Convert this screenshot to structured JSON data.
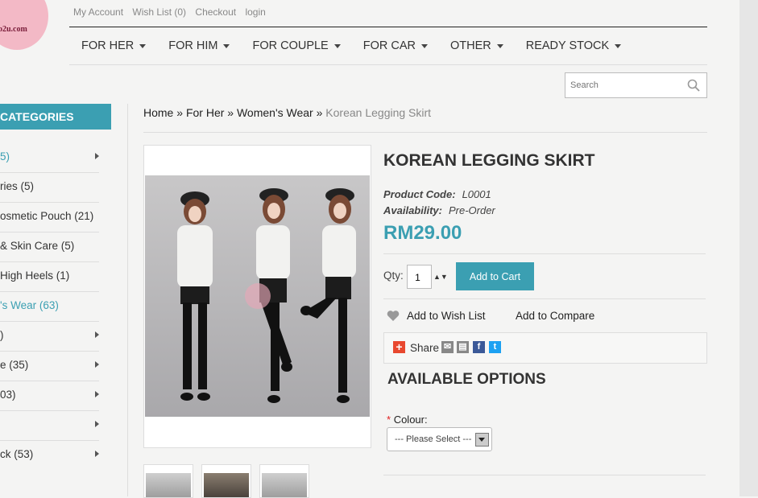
{
  "logo": {
    "text": "o2u.com"
  },
  "top_links": [
    "My Account",
    "Wish List (0)",
    "Checkout",
    "login"
  ],
  "nav": [
    "FOR HER",
    "FOR HIM",
    "FOR COUPLE",
    "FOR CAR",
    "OTHER",
    "READY STOCK"
  ],
  "search": {
    "placeholder": "Search"
  },
  "sidebar": {
    "heading": "CATEGORIES",
    "items": [
      {
        "label": "5)",
        "arrow": true,
        "highlight": true
      },
      {
        "label": "ries (5)",
        "arrow": false,
        "highlight": false
      },
      {
        "label": "osmetic Pouch (21)",
        "arrow": false,
        "highlight": false
      },
      {
        "label": "& Skin Care (5)",
        "arrow": false,
        "highlight": false
      },
      {
        "label": " High Heels (1)",
        "arrow": false,
        "highlight": false
      },
      {
        "label": "'s Wear (63)",
        "arrow": false,
        "highlight": true
      },
      {
        "label": ")",
        "arrow": true,
        "highlight": false
      },
      {
        "label": "e (35)",
        "arrow": true,
        "highlight": false
      },
      {
        "label": "03)",
        "arrow": true,
        "highlight": false
      },
      {
        "label": "",
        "arrow": true,
        "highlight": false
      },
      {
        "label": "ck (53)",
        "arrow": true,
        "highlight": false
      }
    ]
  },
  "breadcrumb": {
    "home": "Home",
    "sep": "»",
    "l1": "For Her",
    "l2": "Women's Wear",
    "current": "Korean Legging Skirt"
  },
  "product": {
    "title": "KOREAN LEGGING SKIRT",
    "code_label": "Product Code:",
    "code": "L0001",
    "availability_label": "Availability:",
    "availability": "Pre-Order",
    "price": "RM29.00",
    "qty_label": "Qty:",
    "qty_value": "1",
    "qty_arrows": "▲▼",
    "add_to_cart": "Add to Cart",
    "wishlist": "Add to Wish List",
    "compare": "Add to Compare",
    "share": "Share",
    "options_heading": "AVAILABLE OPTIONS",
    "colour_required": "*",
    "colour_label": "Colour:",
    "colour_select": "--- Please Select ---"
  },
  "colors": {
    "accent": "#3b9fb2",
    "share_red": "#e8482f",
    "facebook": "#3b5998",
    "twitter": "#1da1f2"
  }
}
